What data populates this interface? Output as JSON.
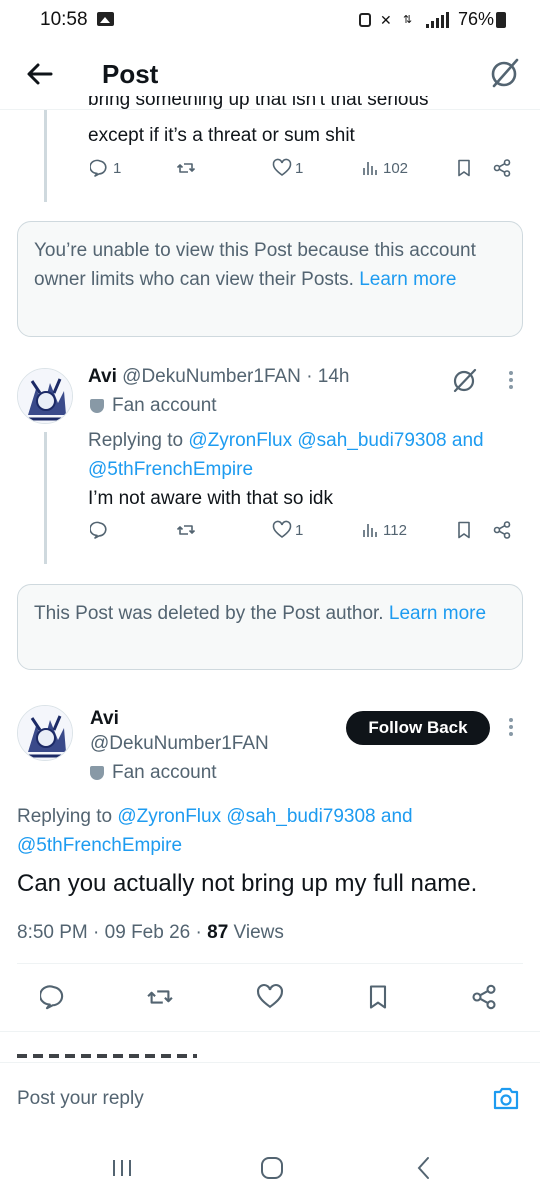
{
  "status_bar": {
    "time": "10:58",
    "battery": "76%"
  },
  "app_bar": {
    "title": "Post"
  },
  "tweet1": {
    "text_clipped": "bring something up that isn't that serious",
    "text_line": "except if it’s a threat or sum shit",
    "replies": "1",
    "likes": "1",
    "views": "102"
  },
  "notice1": {
    "text": "You’re unable to view this Post because this account owner limits who can view their Posts.",
    "link": "Learn more"
  },
  "tweet2": {
    "name": "Avi",
    "handle": "@DekuNumber1FAN",
    "time": "· 14h",
    "badge": "Fan account",
    "replying_prefix": "Replying to",
    "mention1": "@ZyronFlux",
    "mention2": "@sah_budi79308",
    "and": "and",
    "mention3": "@5thFrenchEmpire",
    "text": "I’m not aware with that so idk",
    "likes": "1",
    "views": "112"
  },
  "notice2": {
    "text": "This Post was deleted by the Post author.",
    "link": "Learn more"
  },
  "main_post": {
    "name": "Avi",
    "handle": "@DekuNumber1FAN",
    "badge": "Fan account",
    "follow_label": "Follow Back",
    "replying_prefix": "Replying to",
    "mention1": "@ZyronFlux",
    "mention2": "@sah_budi79308",
    "and": "and",
    "mention3": "@5thFrenchEmpire",
    "text": "Can you actually not bring up my full name.",
    "time": "8:50 PM",
    "date": "09 Feb 26",
    "views_count": "87",
    "views_label": "Views"
  },
  "reply_bar": {
    "placeholder": "Post your reply"
  },
  "colors": {
    "accent": "#1d9bf0",
    "muted": "#536471",
    "text": "#0f1419"
  },
  "icons": [
    "back-arrow-icon",
    "grok-icon",
    "reply-icon",
    "repost-icon",
    "like-icon",
    "views-icon",
    "bookmark-icon",
    "share-icon",
    "camera-icon",
    "more-icon"
  ]
}
